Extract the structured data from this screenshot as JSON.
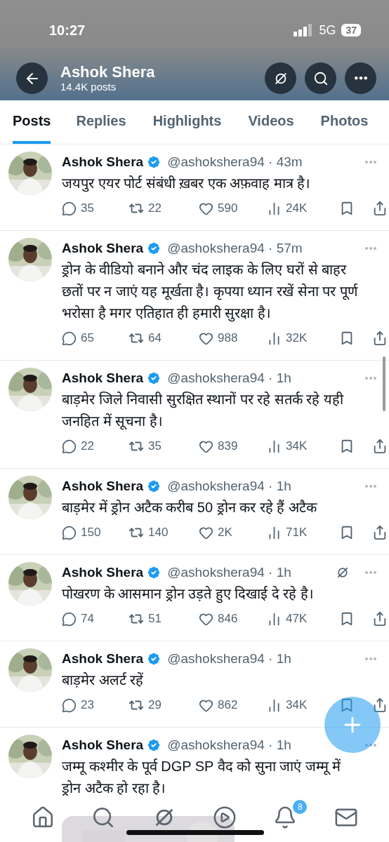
{
  "status_bar": {
    "time": "10:27",
    "network": "5G",
    "battery": "37"
  },
  "profile": {
    "name": "Ashok Shera",
    "posts_count": "14.4K posts"
  },
  "tabs": [
    {
      "label": "Posts",
      "selected": true
    },
    {
      "label": "Replies",
      "selected": false
    },
    {
      "label": "Highlights",
      "selected": false
    },
    {
      "label": "Videos",
      "selected": false
    },
    {
      "label": "Photos",
      "selected": false
    }
  ],
  "posts": [
    {
      "name": "Ashok Shera",
      "verified": true,
      "meta": "@ashokshera94 · 43m",
      "text": "जयपुर एयर पोर्ट संबंधी ख़बर एक अफ़वाह मात्र है।",
      "replies": "35",
      "reposts": "22",
      "likes": "590",
      "views": "24K"
    },
    {
      "name": "Ashok Shera",
      "verified": true,
      "meta": "@ashokshera94 · 57m",
      "text": "ड्रोन के वीडियो बनाने और चंद लाइक के लिए घरों से बाहर छतों पर न जाएं यह मूर्खता है। कृपया ध्यान रखें सेना पर पूर्ण भरोसा है मगर एतिहात ही हमारी सुरक्षा है।",
      "replies": "65",
      "reposts": "64",
      "likes": "988",
      "views": "32K"
    },
    {
      "name": "Ashok Shera",
      "verified": true,
      "meta": "@ashokshera94 · 1h",
      "text": "बाड़मेर जिले निवासी सुरक्षित स्थानों पर रहे सतर्क रहे यही जनहित में सूचना है।",
      "replies": "22",
      "reposts": "35",
      "likes": "839",
      "views": "34K"
    },
    {
      "name": "Ashok Shera",
      "verified": true,
      "meta": "@ashokshera94 · 1h",
      "text": "बाड़मेर में ड्रोन अटैक करीब 50 ड्रोन कर रहे हैं अटैक",
      "replies": "150",
      "reposts": "140",
      "likes": "2K",
      "views": "71K"
    },
    {
      "name": "Ashok Shera",
      "verified": true,
      "meta": "@ashokshera94 · 1h",
      "grok_icon": true,
      "text": "पोखरण के आसमान ड्रोन उड़ते हुए दिखाई दे रहे है।",
      "replies": "74",
      "reposts": "51",
      "likes": "846",
      "views": "47K"
    },
    {
      "name": "Ashok Shera",
      "verified": true,
      "meta": "@ashokshera94 · 1h",
      "text": "बाड़मेर अलर्ट रहें",
      "replies": "23",
      "reposts": "29",
      "likes": "862",
      "views": "34K"
    },
    {
      "name": "Ashok Shera",
      "verified": true,
      "meta": "@ashokshera94 · 1h",
      "text": "जम्मू कश्मीर के पूर्व DGP SP वैद को सुना जाएं जम्मू में ड्रोन अटैक हो रहा है।"
    }
  ],
  "bottom_nav": [
    {
      "kind": "home"
    },
    {
      "kind": "search"
    },
    {
      "kind": "grok"
    },
    {
      "kind": "video"
    },
    {
      "kind": "notifications",
      "badge": "8"
    },
    {
      "kind": "messages"
    }
  ]
}
